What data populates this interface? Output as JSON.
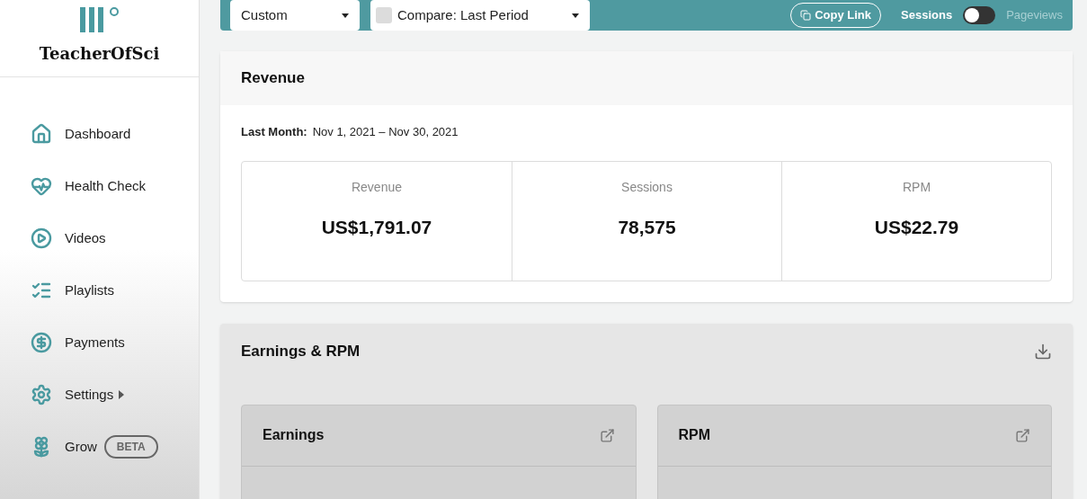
{
  "sidebar": {
    "brand": "TeacherOfSci",
    "items": [
      {
        "label": "Dashboard",
        "selected": false
      },
      {
        "label": "Health Check",
        "selected": false
      },
      {
        "label": "Videos",
        "selected": false
      },
      {
        "label": "Playlists",
        "selected": false
      },
      {
        "label": "Payments",
        "selected": false
      },
      {
        "label": "Settings",
        "selected": false,
        "submenu": true
      },
      {
        "label": "Grow",
        "selected": false,
        "badge": "BETA"
      }
    ]
  },
  "toolbar": {
    "range": "Custom",
    "compare": {
      "label": "Compare: Last Period",
      "checked": false
    },
    "copy_link": "Copy Link",
    "metric_toggle": {
      "left_label": "Sessions",
      "right_label": "Pageviews",
      "on": false
    }
  },
  "revenue": {
    "title": "Revenue",
    "period_label": "Last Month:",
    "period": "Nov 1, 2021 – Nov 30, 2021",
    "stats": [
      {
        "label": "Revenue",
        "value": "US$1,791.07"
      },
      {
        "label": "Sessions",
        "value": "78,575"
      },
      {
        "label": "RPM",
        "value": "US$22.79"
      }
    ]
  },
  "earnings": {
    "title": "Earnings & RPM",
    "panels": [
      {
        "title": "Earnings"
      },
      {
        "title": "RPM"
      }
    ]
  }
}
